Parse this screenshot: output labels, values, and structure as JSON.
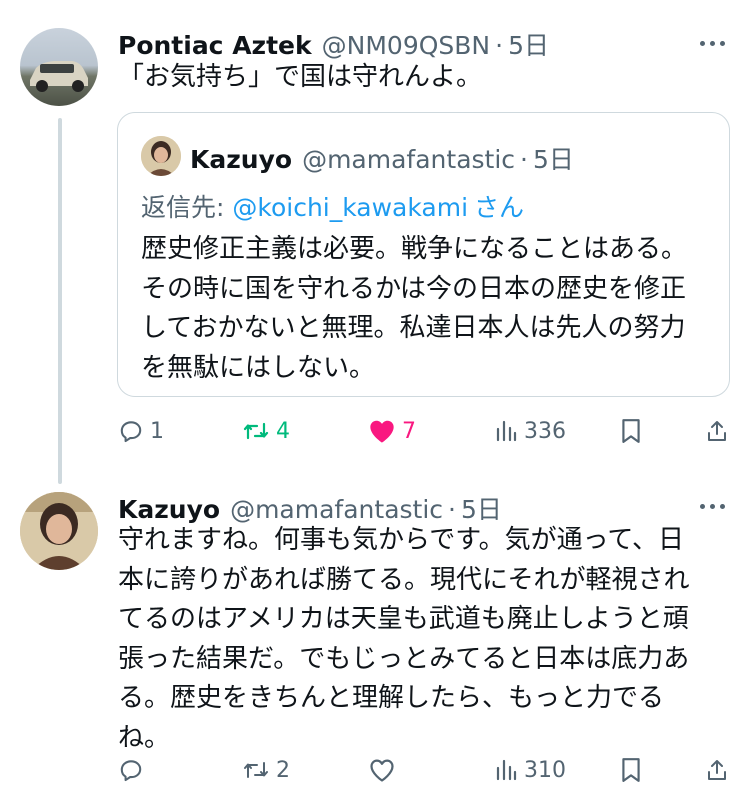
{
  "tweet1": {
    "name": "Pontiac Aztek",
    "handle": "@NM09QSBN",
    "separator": "·",
    "time": "5日",
    "text": "「お気持ち」で国は守れんよ。",
    "quote": {
      "name": "Kazuyo",
      "handle": "@mamafantastic",
      "separator": "·",
      "time": "5日",
      "replying_label": "返信先: ",
      "replying_mention": "@koichi_kawakami",
      "replying_suffix": "さん",
      "lines": [
        "歴史修正主義は必要。戦争になることはある。",
        "その時に国を守れるかは今の日本の歴史を修正",
        "しておかないと無理。私達日本人は先人の努力",
        "を無駄にはしない。"
      ]
    },
    "actions": {
      "reply_count": "1",
      "retweet_count": "4",
      "like_count": "7",
      "views_count": "336"
    }
  },
  "tweet2": {
    "name": "Kazuyo",
    "handle": "@mamafantastic",
    "separator": "·",
    "time": "5日",
    "lines": [
      "守れますね。何事も気からです。気が通って、日",
      "本に誇りがあれば勝てる。現代にそれが軽視され",
      "てるのはアメリカは天皇も武道も廃止しようと頑",
      "張った結果だ。でもじっとみてると日本は底力あ",
      "る。歴史をきちんと理解したら、もっと力でる",
      "ね。"
    ],
    "actions": {
      "reply_count": "",
      "retweet_count": "2",
      "like_count": "",
      "views_count": "310"
    }
  },
  "colors": {
    "text": "#0f1419",
    "secondary": "#536471",
    "link": "#1d9bf0",
    "retweet": "#00ba7c",
    "like": "#f91880",
    "border": "#cfd9de"
  }
}
